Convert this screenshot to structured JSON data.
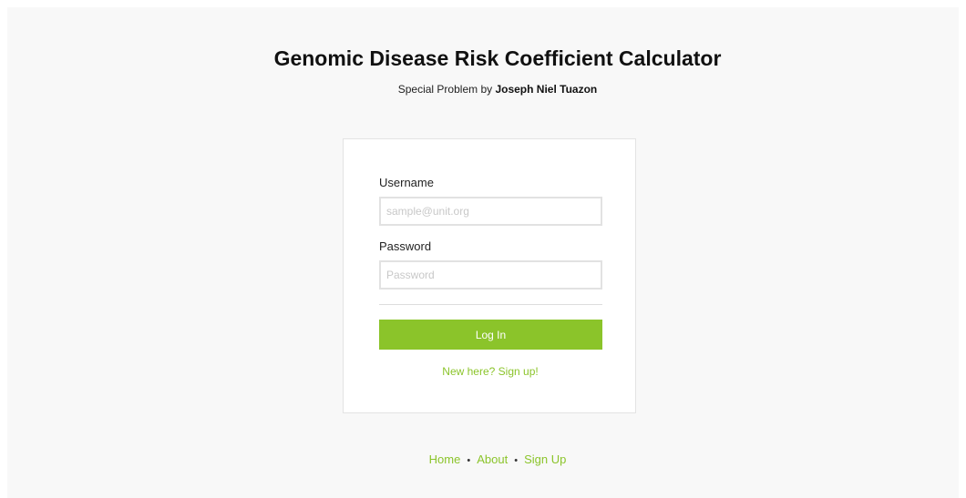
{
  "header": {
    "title": "Genomic Disease Risk Coefficient Calculator",
    "subtitle_prefix": "Special Problem by ",
    "author": "Joseph Niel Tuazon"
  },
  "login_form": {
    "username_label": "Username",
    "username_placeholder": "sample@unit.org",
    "username_value": "",
    "password_label": "Password",
    "password_placeholder": "Password",
    "password_value": "",
    "login_button_label": "Log In",
    "signup_link_label": "New here? Sign up!"
  },
  "footer": {
    "links": [
      {
        "label": "Home"
      },
      {
        "label": "About"
      },
      {
        "label": "Sign Up"
      }
    ],
    "separator": "•"
  },
  "colors": {
    "accent": "#8bc42a",
    "background": "#f8f8f8",
    "card": "#ffffff"
  }
}
